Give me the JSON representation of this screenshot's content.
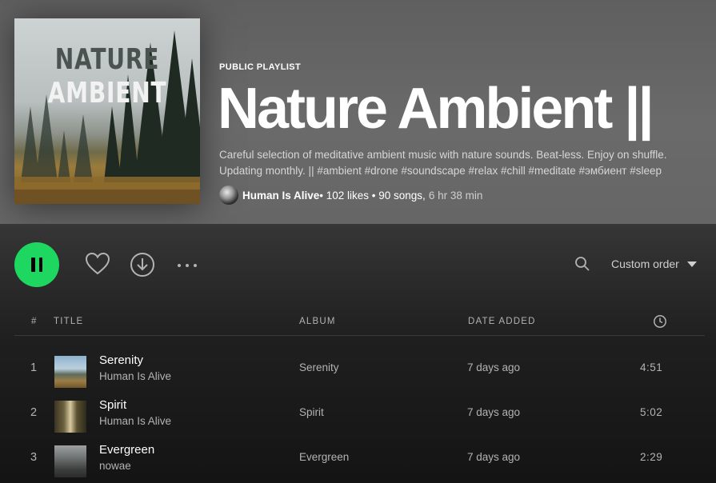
{
  "playlist": {
    "type_label": "PUBLIC PLAYLIST",
    "title": "Nature Ambient ||",
    "cover_line1": "NATURE",
    "cover_line2": "AMBIENT",
    "description": "Careful selection of meditative ambient music with nature sounds. Beat-less. Enjoy on shuffle. Updating monthly. || #ambient #drone #soundscape #relax #chill #meditate #эмбиент #sleep",
    "owner": "Human Is Alive",
    "likes": " • 102 likes • 90 songs,",
    "duration": "6 hr 38 min"
  },
  "controls": {
    "play_state": "pause",
    "sort_label": "Custom order",
    "icons": [
      "pause-icon",
      "heart-icon",
      "download-icon",
      "more-icon",
      "search-icon",
      "caret-down-icon"
    ]
  },
  "colors": {
    "accent": "#1ed760",
    "background": "#121212"
  },
  "table": {
    "headers": {
      "num": "#",
      "title": "TITLE",
      "album": "ALBUM",
      "date_added": "DATE ADDED",
      "duration_icon": "clock-icon"
    },
    "rows": [
      {
        "num": "1",
        "title": "Serenity",
        "artist": "Human Is Alive",
        "album": "Serenity",
        "date_added": "7 days ago",
        "duration": "4:51"
      },
      {
        "num": "2",
        "title": "Spirit",
        "artist": "Human Is Alive",
        "album": "Spirit",
        "date_added": "7 days ago",
        "duration": "5:02"
      },
      {
        "num": "3",
        "title": "Evergreen",
        "artist": "nowae",
        "album": "Evergreen",
        "date_added": "7 days ago",
        "duration": "2:29"
      }
    ]
  }
}
